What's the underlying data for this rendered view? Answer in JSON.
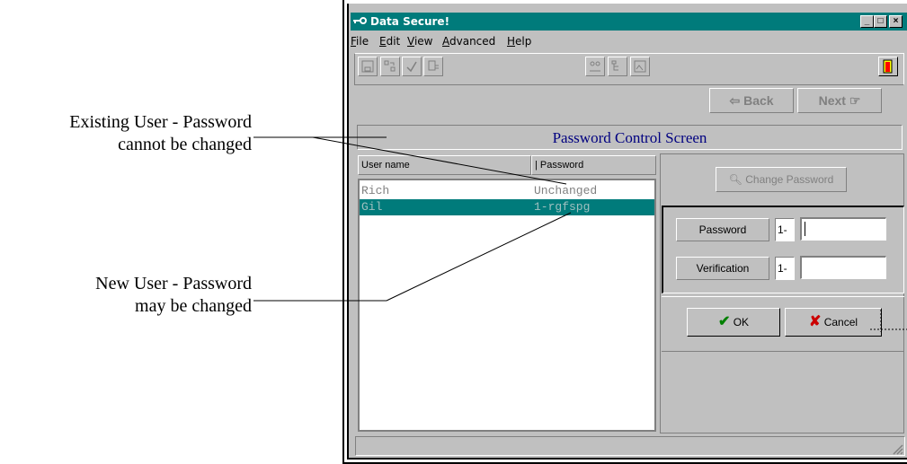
{
  "annotations": {
    "existing_line1": "Existing User - Password",
    "existing_line2": "cannot be changed",
    "new_line1": "New User - Password",
    "new_line2": "may be changed"
  },
  "window": {
    "title": "Data Secure!",
    "controls": {
      "minimize": "_",
      "maximize": "□",
      "close": "×"
    }
  },
  "menu": [
    {
      "label": "File",
      "underline": "F"
    },
    {
      "label": "Edit",
      "underline": "E"
    },
    {
      "label": "View",
      "underline": "V"
    },
    {
      "label": "Advanced",
      "underline": "A"
    },
    {
      "label": "Help",
      "underline": "H"
    }
  ],
  "toolbar": {
    "icons": [
      "save-icon",
      "move-icon",
      "check-icon",
      "list-icon",
      "users-icon",
      "tree-icon",
      "image-icon",
      "exit-door-icon"
    ]
  },
  "nav": {
    "back_label": "Back",
    "next_label": "Next"
  },
  "screen": {
    "heading": "Password Control Screen"
  },
  "user_list": {
    "columns": [
      "User name",
      "| Password"
    ],
    "rows": [
      {
        "user": "Rich",
        "password": "Unchanged",
        "selected": false
      },
      {
        "user": "Gil",
        "password": "1-rgfspg",
        "selected": true
      }
    ]
  },
  "change_password": {
    "button_label": "Change Password",
    "password_label": "Password",
    "password_prefix": "1-",
    "password_value": "",
    "verification_label": "Verification",
    "verification_prefix": "1-",
    "verification_value": ""
  },
  "actions": {
    "ok_label": "OK",
    "cancel_label": "Cancel"
  },
  "colors": {
    "title_bar": "#007b7b",
    "selection": "#007b7b",
    "heading_text": "#000080",
    "disabled_text": "#808080"
  }
}
